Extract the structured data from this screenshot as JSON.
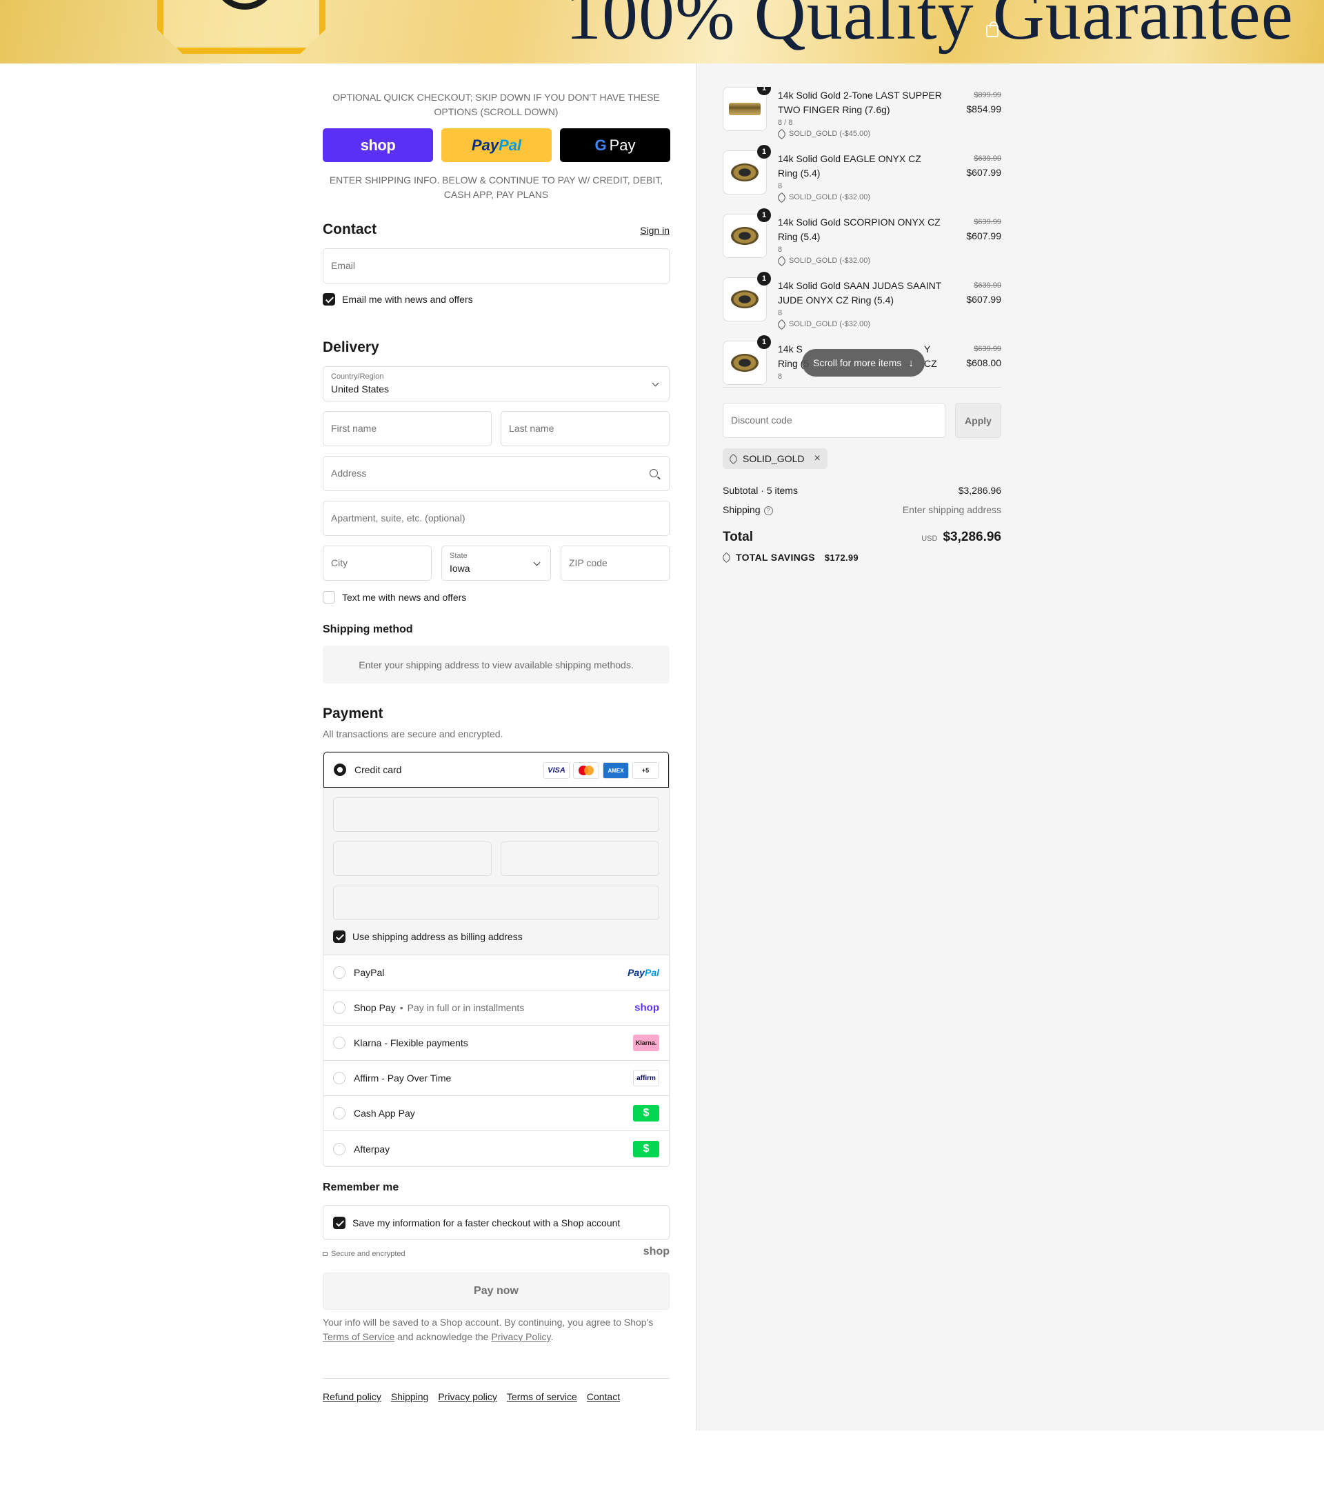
{
  "banner": {
    "title": "100% Quality Guarantee"
  },
  "express": {
    "notice": "OPTIONAL QUICK CHECKOUT; SKIP DOWN IF YOU DON'T HAVE THESE OPTIONS (SCROLL DOWN)",
    "shop_label": "shop",
    "paypal_label_1": "Pay",
    "paypal_label_2": "Pal",
    "gpay_label": "Pay",
    "gpay_g": "G",
    "shipping_notice": "ENTER SHIPPING INFO. BELOW & CONTINUE TO PAY W/ CREDIT, DEBIT, CASH APP, PAY PLANS"
  },
  "contact": {
    "title": "Contact",
    "sign_in": "Sign in",
    "email_placeholder": "Email",
    "email_news_label": "Email me with news and offers"
  },
  "delivery": {
    "title": "Delivery",
    "country_label": "Country/Region",
    "country_value": "United States",
    "first_name_placeholder": "First name",
    "last_name_placeholder": "Last name",
    "address_placeholder": "Address",
    "apartment_placeholder": "Apartment, suite, etc. (optional)",
    "city_placeholder": "City",
    "state_label": "State",
    "state_value": "Iowa",
    "zip_placeholder": "ZIP code",
    "text_news_label": "Text me with news and offers"
  },
  "shipping_method": {
    "title": "Shipping method",
    "message": "Enter your shipping address to view available shipping methods."
  },
  "payment": {
    "title": "Payment",
    "subtitle": "All transactions are secure and encrypted.",
    "credit_card_label": "Credit card",
    "card_brands": [
      "VISA",
      "MC",
      "AMEX",
      "+5"
    ],
    "billing_label": "Use shipping address as billing address",
    "methods": [
      {
        "label": "PayPal",
        "sub": "",
        "logo": "paypal"
      },
      {
        "label": "Shop Pay",
        "sub": "Pay in full or in installments",
        "logo": "shop"
      },
      {
        "label": "Klarna - Flexible payments",
        "sub": "",
        "logo": "klarna"
      },
      {
        "label": "Affirm - Pay Over Time",
        "sub": "",
        "logo": "affirm"
      },
      {
        "label": "Cash App Pay",
        "sub": "",
        "logo": "cash"
      },
      {
        "label": "Afterpay",
        "sub": "",
        "logo": "cash"
      }
    ],
    "logos": {
      "paypal_1": "Pay",
      "paypal_2": "Pal",
      "shop": "shop",
      "klarna": "Klarna.",
      "affirm": "affirm",
      "cash": "$"
    }
  },
  "remember": {
    "title": "Remember me",
    "save_label": "Save my information for a faster checkout with a Shop account",
    "secure_label": "Secure and encrypted",
    "shop_logo": "shop"
  },
  "pay_now_label": "Pay now",
  "legal": {
    "text_1": "Your info will be saved to a Shop account. By continuing, you agree to Shop's ",
    "terms_link": "Terms of Service",
    "text_2": " and acknowledge the ",
    "privacy_link": "Privacy Policy",
    "text_3": "."
  },
  "footer": {
    "links": [
      "Refund policy",
      "Shipping",
      "Privacy policy",
      "Terms of service",
      "Contact"
    ]
  },
  "order": {
    "items": [
      {
        "qty": "1",
        "name": "14k Solid Gold 2-Tone LAST SUPPER TWO FINGER Ring (7.6g)",
        "variant": "8 / 8",
        "discount": "SOLID_GOLD (-$45.00)",
        "was": "$899.99",
        "price": "$854.99"
      },
      {
        "qty": "1",
        "name": "14k Solid Gold EAGLE ONYX CZ Ring (5.4)",
        "variant": "8",
        "discount": "SOLID_GOLD (-$32.00)",
        "was": "$639.99",
        "price": "$607.99"
      },
      {
        "qty": "1",
        "name": "14k Solid Gold SCORPION ONYX CZ Ring (5.4)",
        "variant": "8",
        "discount": "SOLID_GOLD (-$32.00)",
        "was": "$639.99",
        "price": "$607.99"
      },
      {
        "qty": "1",
        "name": "14k Solid Gold SAAN JUDAS SAAINT JUDE ONYX CZ Ring (5.4)",
        "variant": "8",
        "discount": "SOLID_GOLD (-$32.00)",
        "was": "$639.99",
        "price": "$607.99"
      },
      {
        "qty": "1",
        "name_a": "14k S",
        "name_b": "Y CZ",
        "name_c": "Ring (5",
        "variant": "8",
        "was": "$639.99",
        "price": "$608.00"
      }
    ],
    "scroll_label": "Scroll for more items",
    "discount_placeholder": "Discount code",
    "apply_label": "Apply",
    "applied_code": "SOLID_GOLD",
    "subtotal_label": "Subtotal · 5 items",
    "subtotal_value": "$3,286.96",
    "shipping_label": "Shipping",
    "shipping_value": "Enter shipping address",
    "total_label": "Total",
    "currency": "USD",
    "total_value": "$3,286.96",
    "savings_label": "TOTAL SAVINGS",
    "savings_value": "$172.99"
  }
}
